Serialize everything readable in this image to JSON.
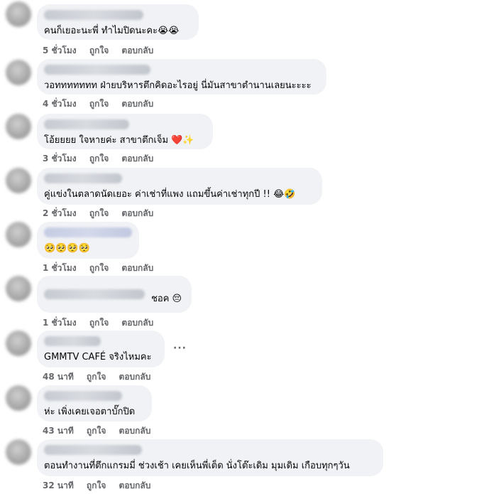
{
  "actions": {
    "like": "ถูกใจ",
    "reply": "ตอบกลับ"
  },
  "comments": [
    {
      "text": "คนก็เยอะนะพี่ ทำไมปิดนะคะ😭😭",
      "time": "5 ชั่วโมง"
    },
    {
      "text": "วอททททททท ฝ่ายบริหารตึกคิดอะไรอยู่ นี่มันสาขาตำนานเลยนะะะะ",
      "time": "4 ชั่วโมง"
    },
    {
      "text": "โอ้ยยยย ใจหายค่ะ สาขาตึกเจ็ม ❤️✨",
      "time": "3 ชั่วโมง"
    },
    {
      "text": "คู่แข่งในตลาดนัดเยอะ ค่าเช่าที่แพง แถมขึ้นค่าเช่าทุกปี !! 😂🤣",
      "time": "2 ชั่วโมง"
    },
    {
      "text": "🥺🥺🥺🥺",
      "time": "1 ชั่วโมง"
    },
    {
      "text": "ชอค 😔",
      "time": "1 ชั่วโมง"
    },
    {
      "text": "GMMTV CAFÉ จริงไหมคะ",
      "time": "48 นาที",
      "more": "···"
    },
    {
      "text": "ห่ะ เพิ่งเคยเจอตาบั๊กปิด",
      "time": "43 นาที"
    },
    {
      "text": "ตอนทำงานที่ตึกแกรมมี่ ช่วงเช้า เคยเห็นพี่เต็ด นั่งโต๊ะเดิม มุมเดิม เกือบทุกๆวัน",
      "time": "32 นาที"
    }
  ]
}
